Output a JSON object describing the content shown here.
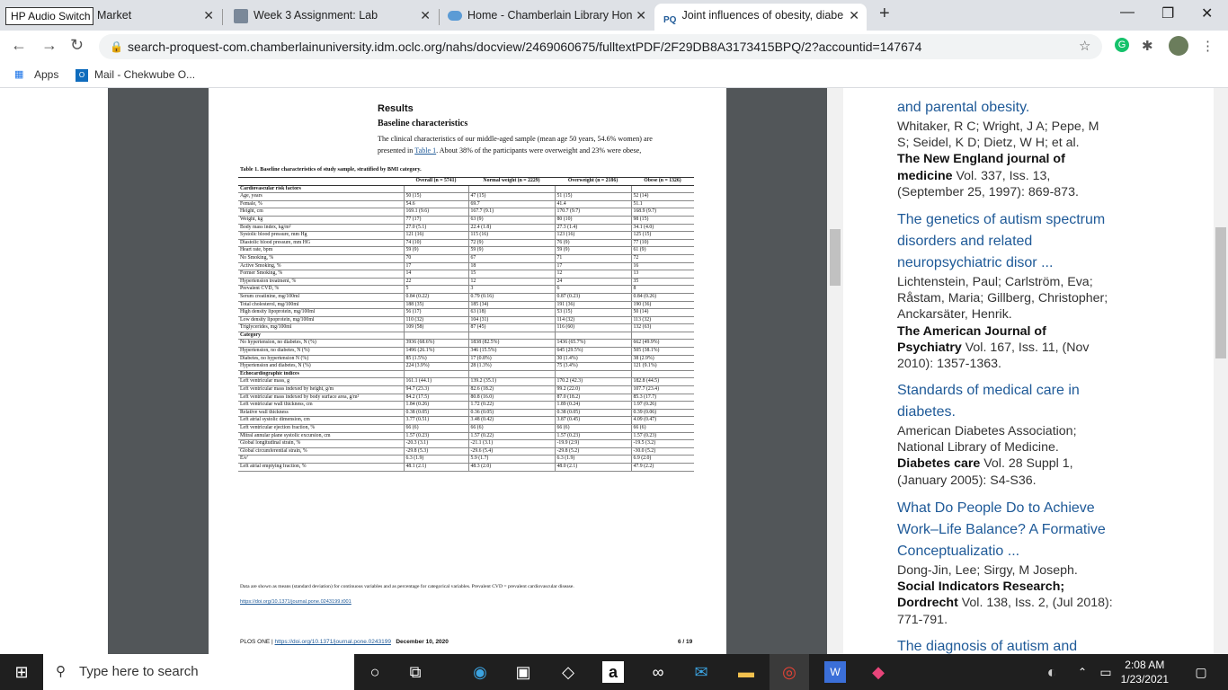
{
  "overlay_label": "HP Audio Switch",
  "tabs": [
    {
      "label": "Market",
      "icon": "blank-icon"
    },
    {
      "label": "Week 3 Assignment: Lab",
      "icon": "document-icon"
    },
    {
      "label": "Home - Chamberlain Library Hon",
      "icon": "cloud-icon"
    },
    {
      "label": "Joint influences of obesity, diabe",
      "icon": "proquest-icon",
      "active": true
    }
  ],
  "url": "search-proquest-com.chamberlainuniversity.idm.oclc.org/nahs/docview/2469060675/fulltextPDF/2F29DB8A3173415BPQ/2?accountid=147674",
  "bookmarks": [
    "Apps",
    "Mail - Chekwube O..."
  ],
  "pdf": {
    "h_results": "Results",
    "h_baseline": "Baseline characteristics",
    "para1": "The clinical characteristics of our middle-aged sample (mean age 50 years, 54.6% women) are",
    "para2a": "presented in ",
    "para2link": "Table 1",
    "para2b": ". About 38% of the participants were overweight and 23% were obese,",
    "table_caption": "Table 1. Baseline characteristics of study sample, stratified by BMI category.",
    "headers": [
      "",
      "Overall (n = 5741)",
      "Normal weight (n = 2229)",
      "Overweight (n = 2186)",
      "Obese (n = 1326)"
    ],
    "rows": [
      [
        "Cardiovascular risk factors",
        "",
        "",
        "",
        ""
      ],
      [
        "Age, years",
        "50 (15)",
        "47 (15)",
        "51 (15)",
        "52 (14)"
      ],
      [
        "Female, %",
        "54.6",
        "69.7",
        "41.4",
        "51.1"
      ],
      [
        "Height, cm",
        "169.1 (9.6)",
        "167.7 (9.1)",
        "170.7 (9.7)",
        "168.9 (9.7)"
      ],
      [
        "Weight, kg",
        "77 (17)",
        "63 (9)",
        "80 (10)",
        "98 (15)"
      ],
      [
        "Body mass index, kg/m²",
        "27.0 (5.1)",
        "22.4 (1.8)",
        "27.3 (1.4)",
        "34.1 (4.0)"
      ],
      [
        "Systolic blood pressure, mm Hg",
        "121 (16)",
        "115 (16)",
        "123 (16)",
        "125 (15)"
      ],
      [
        "Diastolic blood pressure, mm HG",
        "74 (10)",
        "72 (9)",
        "76 (9)",
        "77 (10)"
      ],
      [
        "Heart rate, bpm",
        "59 (9)",
        "59 (9)",
        "59 (9)",
        "61 (9)"
      ],
      [
        "No Smoking, %",
        "70",
        "67",
        "71",
        "72"
      ],
      [
        "Active Smoking, %",
        "17",
        "18",
        "17",
        "16"
      ],
      [
        "Former Smoking, %",
        "14",
        "15",
        "12",
        "13"
      ],
      [
        "Hypertension treatment, %",
        "22",
        "12",
        "24",
        "35"
      ],
      [
        "Prevalent CVD, %",
        "5",
        "3",
        "6",
        "8"
      ],
      [
        "Serum creatinine, mg/100ml",
        "0.84 (0.22)",
        "0.79 (0.16)",
        "0.87 (0.23)",
        "0.84 (0.26)"
      ],
      [
        "Total cholesterol, mg/100ml",
        "188 (35)",
        "185 (34)",
        "191 (36)",
        "190 (36)"
      ],
      [
        "High density lipoprotein, mg/100ml",
        "56 (17)",
        "63 (18)",
        "53 (15)",
        "50 (14)"
      ],
      [
        "Low density lipoprotein, mg/100ml",
        "110 (32)",
        "104 (31)",
        "114 (32)",
        "113 (32)"
      ],
      [
        "Triglycerides, mg/100ml",
        "109 (58)",
        "87 (45)",
        "116 (60)",
        "132 (63)"
      ],
      [
        "Category",
        "",
        "",
        "",
        ""
      ],
      [
        "No hypertension, no diabetes, N (%)",
        "3936 (68.6%)",
        "1838 (82.5%)",
        "1436 (65.7%)",
        "662 (49.9%)"
      ],
      [
        "Hypertension, no diabetes, N (%)",
        "1496 (26.1%)",
        "346 (15.5%)",
        "645 (29.5%)",
        "505 (38.1%)"
      ],
      [
        "Diabetes, no hypertension N (%)",
        "85 (1.5%)",
        "17 (0.8%)",
        "30 (1.4%)",
        "38 (2.9%)"
      ],
      [
        "Hypertension and diabetes, N (%)",
        "224 (3.9%)",
        "28 (1.3%)",
        "75 (3.4%)",
        "121 (9.1%)"
      ],
      [
        "Echocardiographic indices",
        "",
        "",
        "",
        ""
      ],
      [
        "Left ventricular mass, g",
        "161.1 (44.1)",
        "139.2 (35.1)",
        "170.2 (42.3)",
        "182.8 (44.5)"
      ],
      [
        "Left ventricular mass indexed by height, g/m",
        "94.7 (23.3)",
        "82.6 (18.2)",
        "99.2 (22.0)",
        "107.7 (23.4)"
      ],
      [
        "Left ventricular mass indexed by body surface area, g/m²",
        "84.2 (17.5)",
        "80.8 (16.0)",
        "87.0 (18.2)",
        "85.3 (17.7)"
      ],
      [
        "Left ventricular wall thickness, cm",
        "1.84 (0.26)",
        "1.72 (0.22)",
        "1.89 (0.24)",
        "1.97 (0.26)"
      ],
      [
        "Relative wall thickness",
        "0.38 (0.05)",
        "0.36 (0.05)",
        "0.38 (0.05)",
        "0.39 (0.06)"
      ],
      [
        "Left atrial systolic dimension, cm",
        "3.77 (0.51)",
        "3.48 (0.42)",
        "3.87 (0.45)",
        "4.09 (0.47)"
      ],
      [
        "Left ventricular ejection fraction, %",
        "66 (6)",
        "66 (6)",
        "66 (6)",
        "66 (6)"
      ],
      [
        "Mitral annular plane systolic excursion, cm",
        "1.57 (0.23)",
        "1.57 (0.22)",
        "1.57 (0.23)",
        "1.57 (0.23)"
      ],
      [
        "Global longitudinal strain, %",
        "-20.3 (3.1)",
        "-21.1 (3.1)",
        "-19.9 (2.9)",
        "-19.5 (3.2)"
      ],
      [
        "Global circumferential strain, %",
        "-29.8 (5.3)",
        "-29.6 (5.4)",
        "-29.8 (5.2)",
        "-30.0 (5.2)"
      ],
      [
        "E/e'",
        "6.3 (1.9)",
        "5.9 (1.7)",
        "6.3 (1.9)",
        "6.9 (2.0)"
      ],
      [
        "Left atrial emptying fraction, %",
        "48.1 (2.1)",
        "48.3 (2.0)",
        "48.0 (2.1)",
        "47.9 (2.2)"
      ]
    ],
    "footnote": "Data are shown as means (standard deviation) for continuous variables and as percentage for categorical variables. Prevalent CVD = prevalent cardiovascular disease.",
    "doi_link": "https://doi.org/10.1371/journal.pone.0243199.t001",
    "footer_journal": "PLOS ONE | ",
    "footer_doi": "https://doi.org/10.1371/journal.pone.0243199",
    "footer_date": "December 10, 2020",
    "footer_page": "6 / 19"
  },
  "references": [
    {
      "title": "and parental obesity.",
      "authors": "Whitaker, R C; Wright, J A; Pepe, M S; Seidel, K D; Dietz, W H; et al.",
      "journal": "The New England journal of medicine",
      "details": " Vol. 337, Iss. 13, (September 25, 1997): 869-873."
    },
    {
      "title": "The genetics of autism spectrum disorders and related neuropsychiatric disor ...",
      "authors": "Lichtenstein, Paul; Carlström, Eva; Råstam, Maria; Gillberg, Christopher; Anckarsäter, Henrik.",
      "journal": "The American Journal of Psychiatry",
      "details": " Vol. 167, Iss. 11, (Nov 2010): 1357-1363."
    },
    {
      "title": "Standards of medical care in diabetes.",
      "authors": "American Diabetes Association; National Library of Medicine.",
      "journal": "Diabetes care",
      "details": " Vol. 28 Suppl 1, (January 2005): S4-S36."
    },
    {
      "title": "What Do People Do to Achieve Work–Life Balance? A Formative Conceptualizatio ...",
      "authors": "Dong-Jin, Lee; Sirgy, M Joseph.",
      "journal": "Social Indicators Research; Dordrecht",
      "details": " Vol. 138, Iss. 2, (Jul 2018): 771-791."
    },
    {
      "title": "The diagnosis of autism and",
      "authors": "",
      "journal": "",
      "details": ""
    }
  ],
  "taskbar": {
    "search_placeholder": "Type here to search",
    "time": "2:08 AM",
    "date": "1/23/2021"
  }
}
